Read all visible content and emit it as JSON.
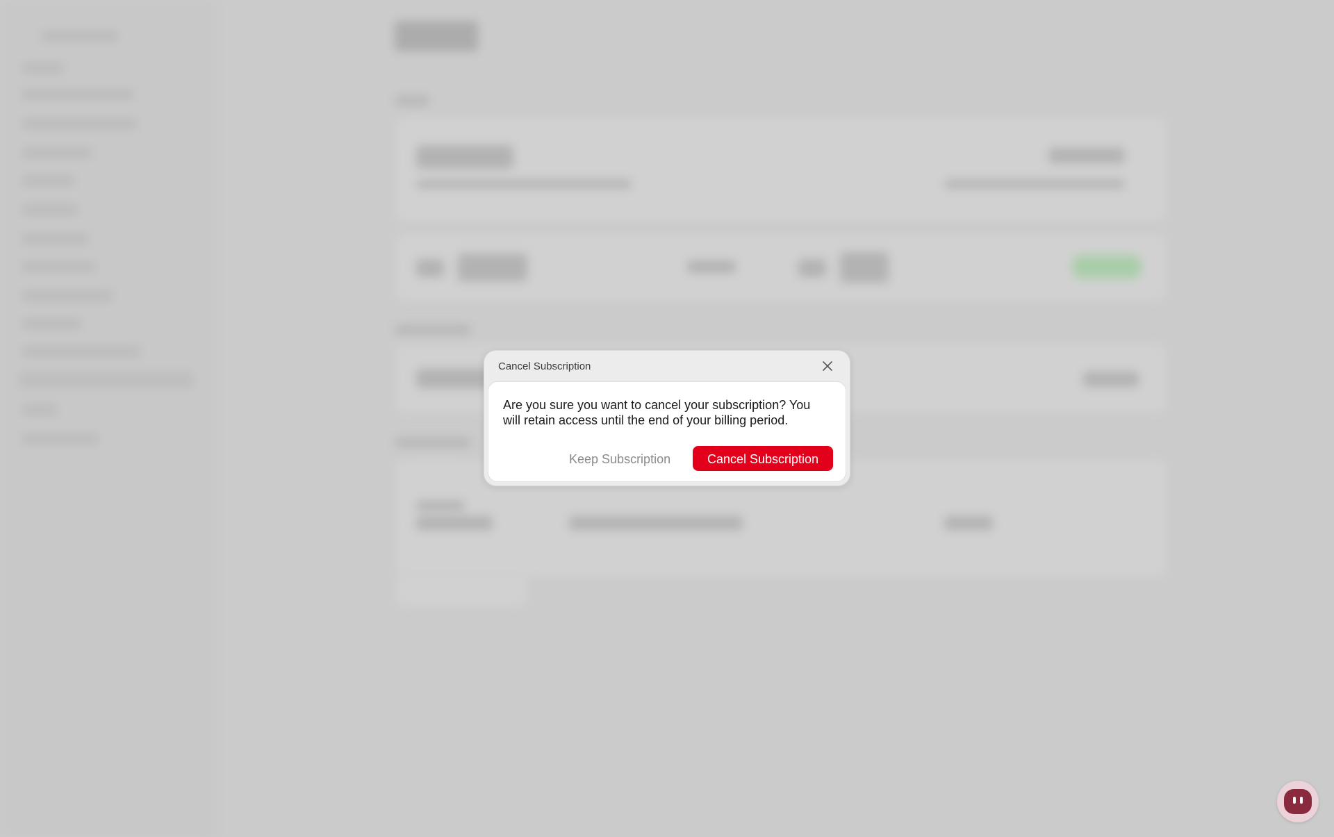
{
  "modal": {
    "title": "Cancel Subscription",
    "message": "Are you sure you want to cancel your subscription? You will retain access until the end of your billing period.",
    "keep_label": "Keep Subscription",
    "confirm_label": "Cancel Subscription",
    "close_icon": "close-icon"
  },
  "colors": {
    "danger": "#e3001b",
    "overlay": "#cbcbcb",
    "modal_header": "#ececec"
  },
  "assistant": {
    "icon": "assistant-avatar-icon"
  }
}
